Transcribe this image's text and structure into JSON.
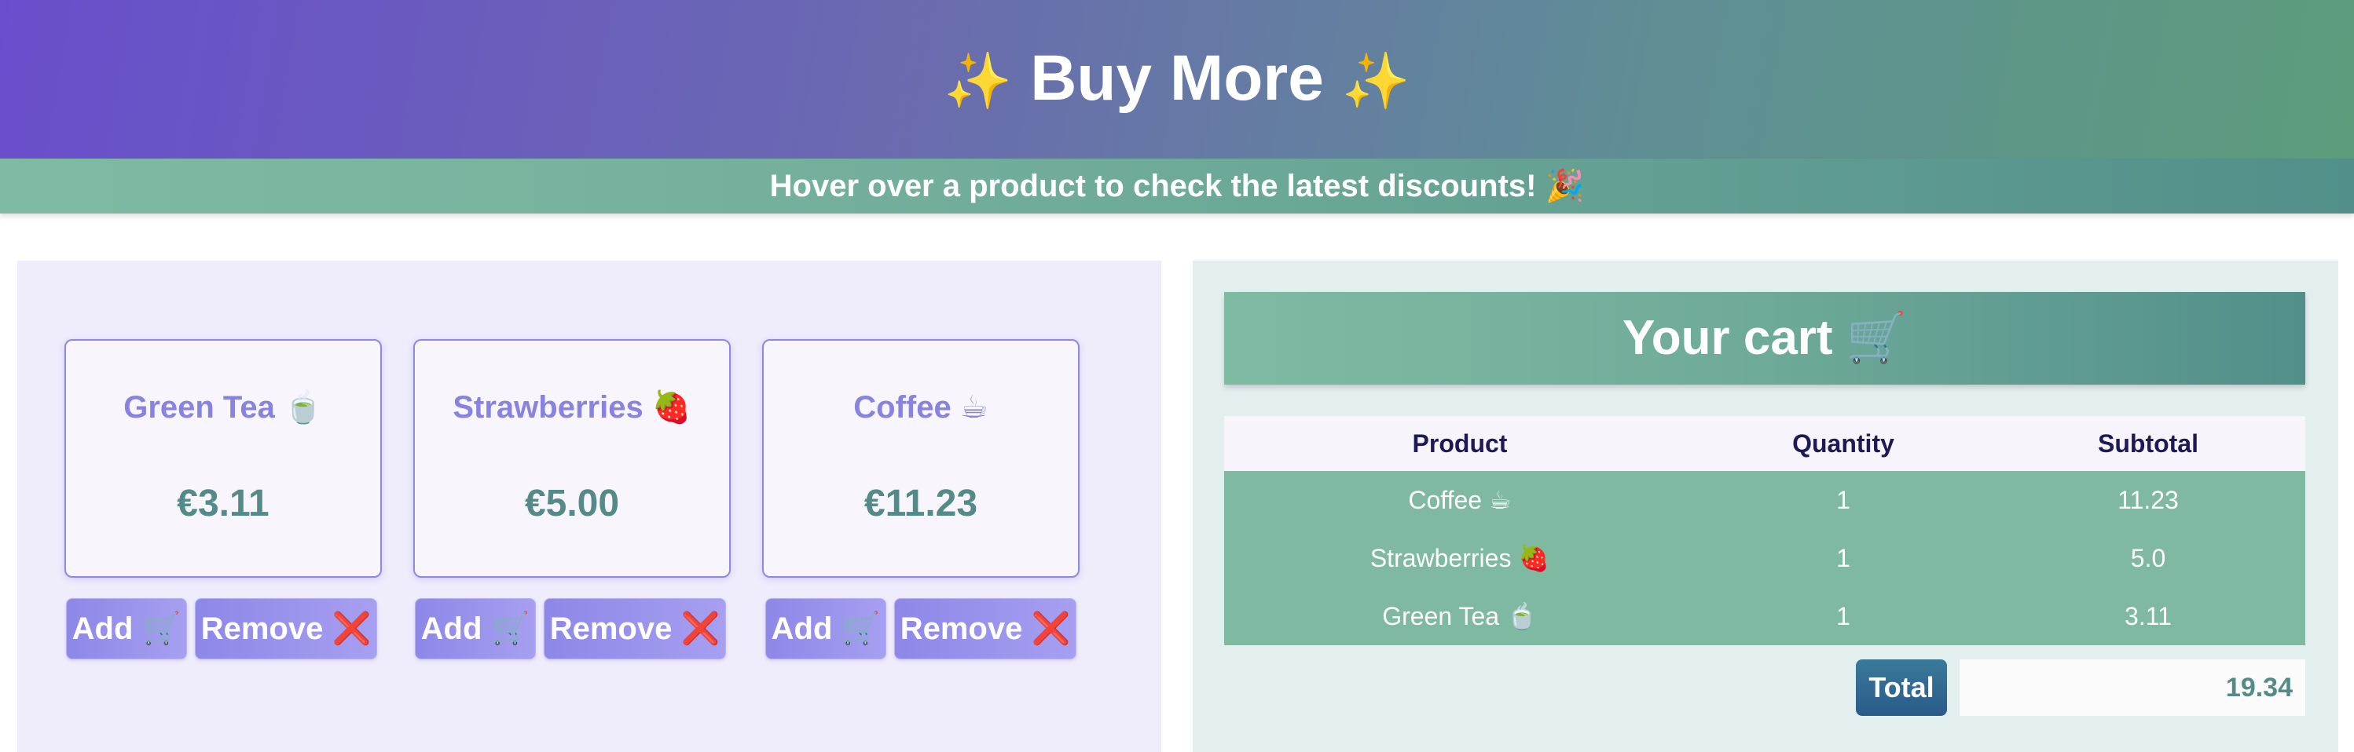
{
  "header": {
    "sparkle_left": "✨",
    "title": "Buy More",
    "sparkle_right": "✨",
    "banner": "Hover over a product to check the latest discounts! 🎉"
  },
  "products": [
    {
      "name": "Green Tea 🍵",
      "price": "€3.11",
      "add_label": "Add 🛒",
      "remove_label": "Remove",
      "remove_icon": "❌"
    },
    {
      "name": "Strawberries 🍓",
      "price": "€5.00",
      "add_label": "Add 🛒",
      "remove_label": "Remove",
      "remove_icon": "❌"
    },
    {
      "name": "Coffee ☕",
      "price": "€11.23",
      "add_label": "Add 🛒",
      "remove_label": "Remove",
      "remove_icon": "❌"
    }
  ],
  "cart": {
    "title": "Your cart 🛒",
    "columns": [
      "Product",
      "Quantity",
      "Subtotal"
    ],
    "rows": [
      {
        "product": "Coffee ☕",
        "quantity": "1",
        "subtotal": "11.23"
      },
      {
        "product": "Strawberries 🍓",
        "quantity": "1",
        "subtotal": "5.0"
      },
      {
        "product": "Green Tea 🍵",
        "quantity": "1",
        "subtotal": "3.11"
      }
    ],
    "total_label": "Total",
    "total_value": "19.34"
  },
  "colors": {
    "accent_purple": "#6a4dcc",
    "accent_green": "#7fbba3",
    "product_text": "#8783e0",
    "price_text": "#548a88",
    "remove_icon": "#d8202e"
  }
}
